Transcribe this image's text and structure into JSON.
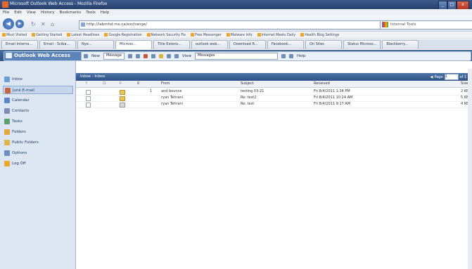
{
  "window": {
    "title": "Microsoft Outlook Web Access - Mozilla Firefox",
    "controls": [
      "_",
      "□",
      "x"
    ]
  },
  "menubar": [
    "File",
    "Edit",
    "View",
    "History",
    "Bookmarks",
    "Tools",
    "Help"
  ],
  "navigation": {
    "address": "http://labmhd.ms.ca/exchange/",
    "search_placeholder": "Internal Tools"
  },
  "bookmarks": [
    "Most Visited",
    "Getting Started",
    "Latest Headlines",
    "Google Registration",
    "Network Security Fix",
    "Free Messenger",
    "Malware Info",
    "Internet Meets Daily",
    "Health Blog Settings"
  ],
  "tabs": [
    "Email Interna...",
    "Email - Sciba...",
    "Nye...",
    "Microso...",
    "Title Extens...",
    "outlook web...",
    "Download R...",
    "Facebook...",
    "On Sites",
    "Status Microso...",
    "Blackberry..."
  ],
  "owa": {
    "logo": "Outlook Web Access",
    "toolbar": {
      "new_label": "New",
      "new_select": "Message",
      "view_label": "View",
      "view_select": "Messages",
      "help_label": "Help"
    },
    "nav": [
      {
        "label": "Inbox",
        "color": "#6a9fd8"
      },
      {
        "label": "Junk E-mail",
        "color": "#c9653c"
      },
      {
        "label": "Calendar",
        "color": "#5b87c6"
      },
      {
        "label": "Contacts",
        "color": "#7a8fb8"
      },
      {
        "label": "Tasks",
        "color": "#5aa06a"
      },
      {
        "label": "Folders",
        "color": "#e2a83c"
      },
      {
        "label": "Public Folders",
        "color": "#e0b64a"
      },
      {
        "label": "Options",
        "color": "#6b8fc0"
      },
      {
        "label": "Log Off",
        "color": "#e6a92e"
      }
    ]
  },
  "inbox": {
    "folder_title": "Inbox - Inbox",
    "pager": {
      "page_label": "Page",
      "page_value": "1",
      "of_label": "of 1"
    },
    "columns": {
      "importance": "!",
      "icon": "☐",
      "flag": "⚐",
      "attach": "0",
      "from": "From",
      "subject": "Subject",
      "received": "Received",
      "size": "Size"
    },
    "messages": [
      {
        "attach": "1",
        "from": "and bounce",
        "subject": "testing 03-21",
        "received": "Fri 8/4/2011 1:34 PM",
        "size": "2 KB"
      },
      {
        "attach": "",
        "from": "ryan Tehrani",
        "subject": "Re: test2",
        "received": "Fri 8/4/2011 10:24 AM",
        "size": "5 KB"
      },
      {
        "attach": "",
        "from": "ryan Tehrani",
        "subject": "Re: test",
        "received": "Fri 8/4/2011 9:17 AM",
        "size": "4 KB"
      }
    ]
  }
}
